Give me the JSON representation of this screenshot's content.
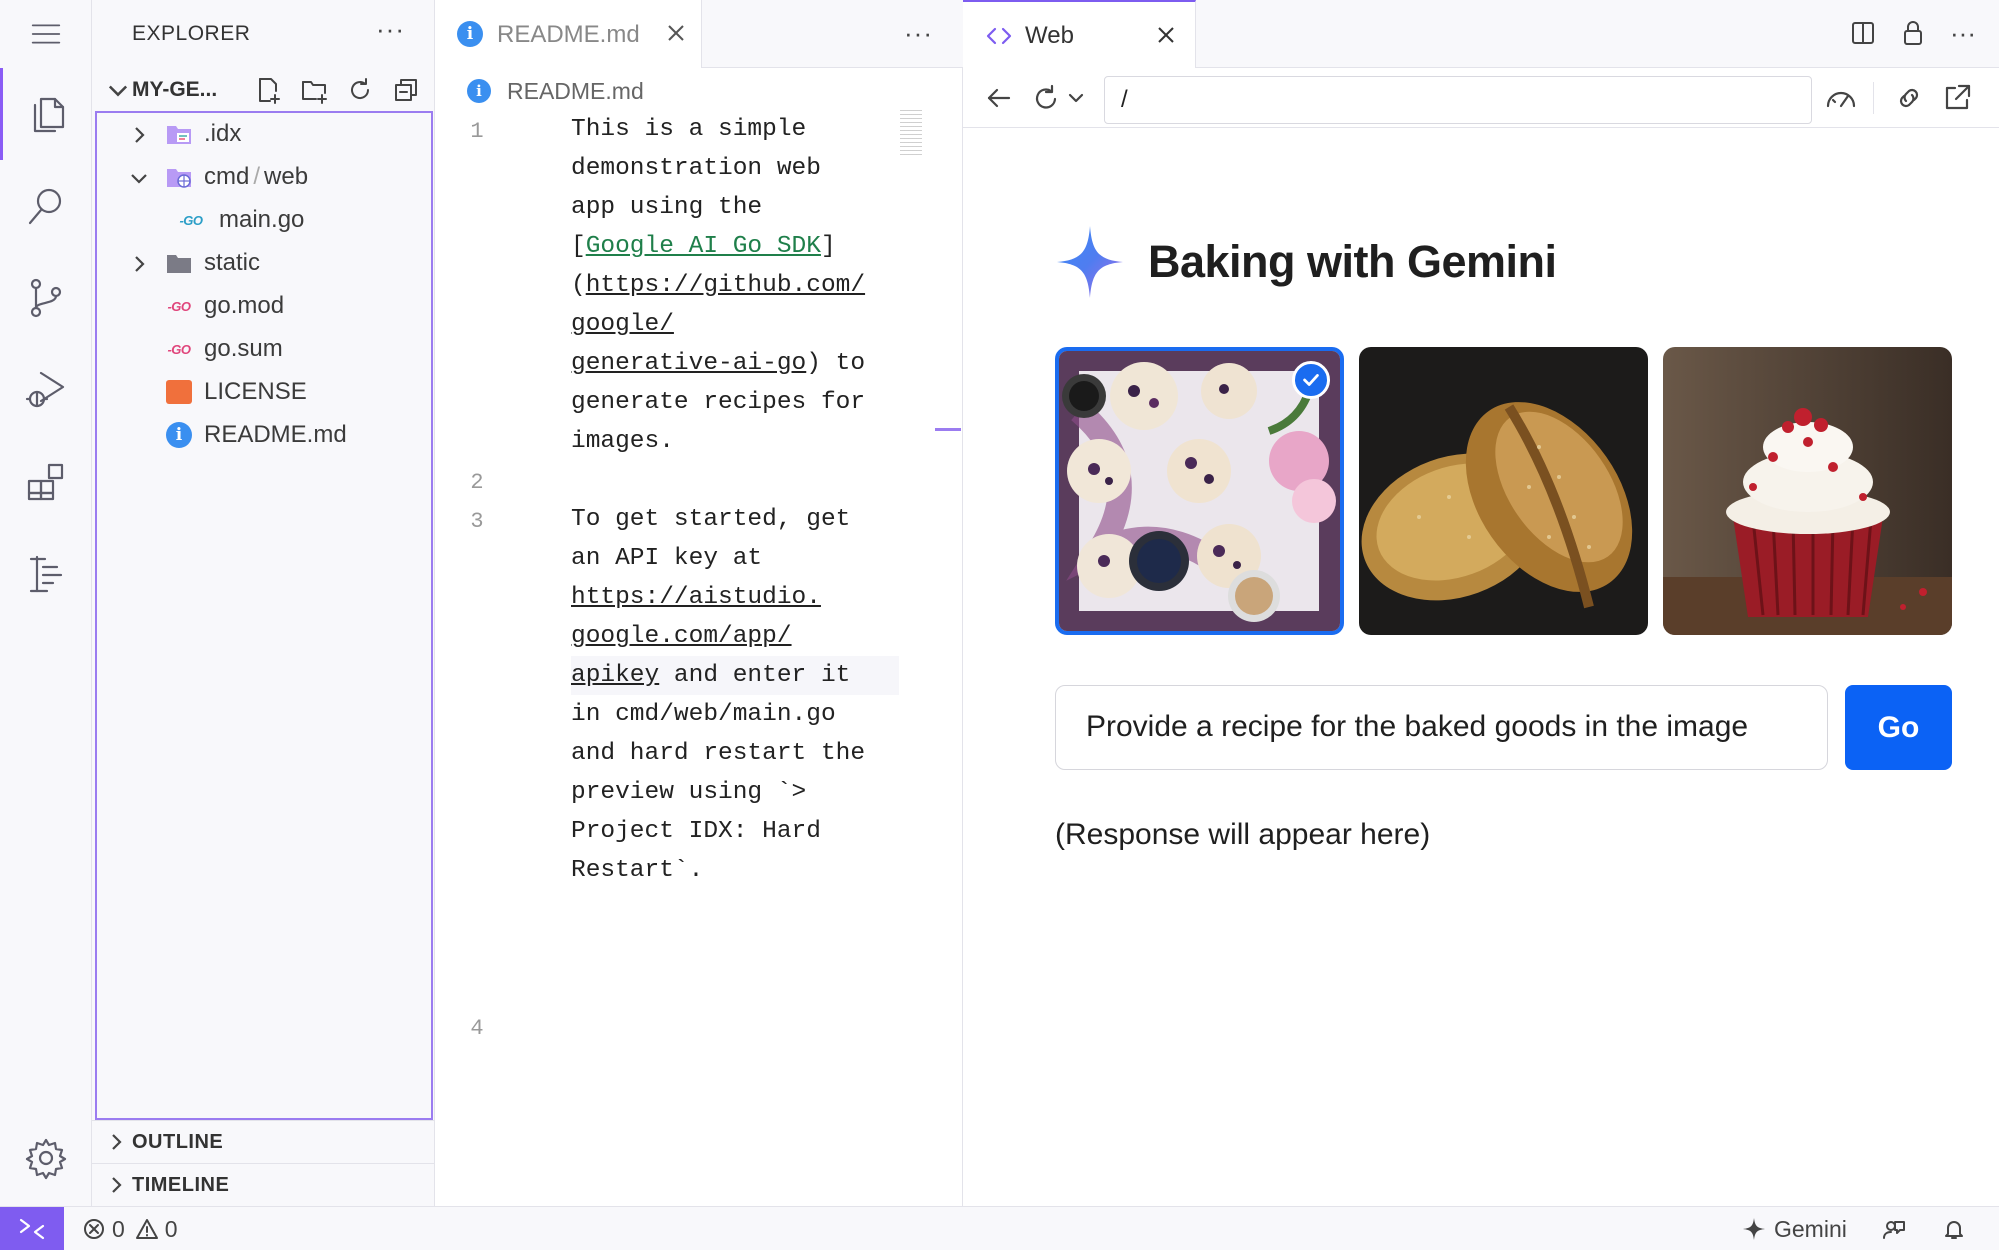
{
  "activity_bar": {
    "items": [
      "explorer-icon",
      "search-icon",
      "source-control-icon",
      "run-debug-icon",
      "extensions-icon",
      "outline-list-icon"
    ],
    "bottom": "settings-gear-icon"
  },
  "sidebar": {
    "title": "EXPLORER",
    "more": "···",
    "project": "MY-GE...",
    "tree": [
      {
        "label": ".idx",
        "kind": "folder-idx",
        "expanded": false
      },
      {
        "label_parts": [
          "cmd",
          "/",
          "web"
        ],
        "kind": "folder-web",
        "expanded": true
      },
      {
        "label": "main.go",
        "kind": "go-file"
      },
      {
        "label": "static",
        "kind": "folder",
        "expanded": false
      },
      {
        "label": "go.mod",
        "kind": "go-mod"
      },
      {
        "label": "go.sum",
        "kind": "go-mod"
      },
      {
        "label": "LICENSE",
        "kind": "license"
      },
      {
        "label": "README.md",
        "kind": "info"
      }
    ],
    "sections": [
      "OUTLINE",
      "TIMELINE"
    ]
  },
  "editor": {
    "tab": "README.md",
    "more": "···",
    "breadcrumb": "README.md",
    "line_numbers": [
      "1",
      "2",
      "3",
      "4"
    ],
    "lines": [
      "This is a simple",
      "demonstration web",
      "app using the",
      "[Google AI Go SDK]",
      "(https://github.com/",
      "google/",
      "generative-ai-go) to",
      "generate recipes for",
      "images.",
      "",
      "To get started, get",
      "an API key at",
      "https://aistudio.",
      "google.com/app/",
      "apikey and enter it",
      "in cmd/web/main.go",
      "and hard restart the",
      "preview using `>",
      "Project IDX: Hard",
      "Restart`.",
      ""
    ],
    "link_text": "Google AI Go SDK"
  },
  "web": {
    "tab": "Web",
    "url": "/",
    "app_title": "Baking with Gemini",
    "images": [
      "blueberry-scones",
      "bread-loaves",
      "red-velvet-cupcake"
    ],
    "selected_image": 0,
    "prompt_value": "Provide a recipe for the baked goods in the image",
    "go_label": "Go",
    "response": "(Response will appear here)"
  },
  "status": {
    "errors": "0",
    "warnings": "0",
    "gemini": "Gemini"
  },
  "colors": {
    "accent": "#7f5cf0",
    "primary_button": "#0b62f5",
    "selection_border": "#1a6cf0"
  }
}
